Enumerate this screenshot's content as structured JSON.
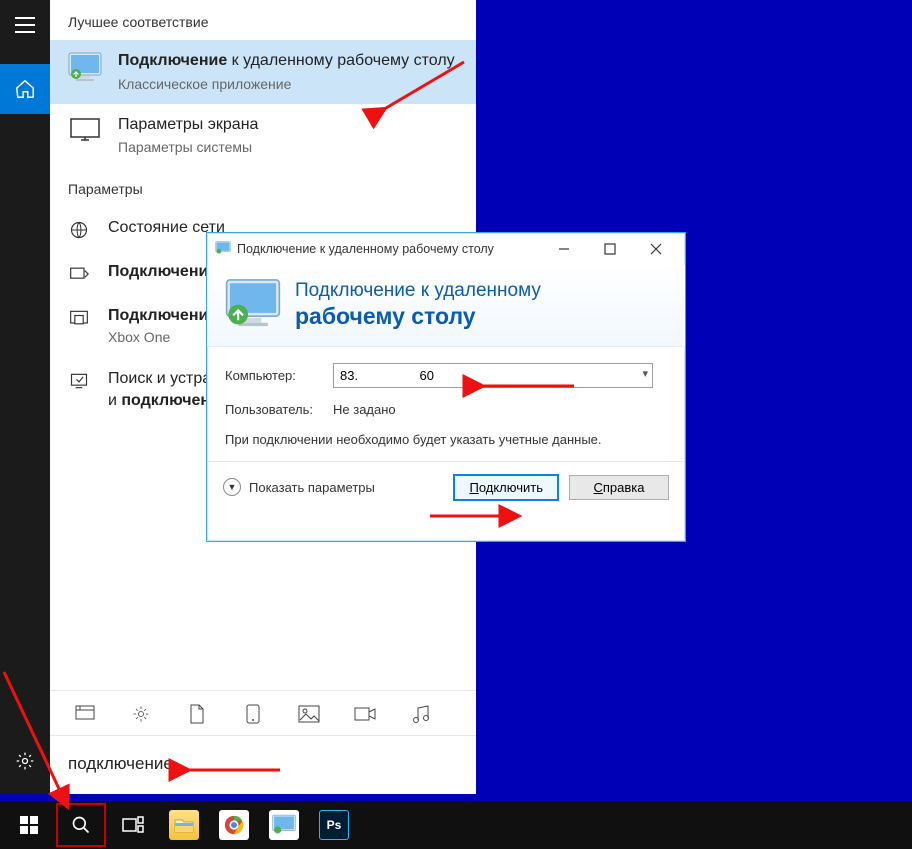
{
  "start": {
    "best_match_label": "Лучшее соответствие",
    "results": [
      {
        "title_prefix": "Подключение",
        "title_rest": " к удаленному рабочему столу",
        "subtitle": "Классическое приложение"
      },
      {
        "title_plain": "Параметры экрана",
        "subtitle": "Параметры системы"
      }
    ],
    "params_label": "Параметры",
    "settings_items": [
      {
        "text": "Состояние сети"
      },
      {
        "text_bold": "Подключение"
      },
      {
        "text_bold_prefix": "Подключение",
        "text_rest_html": "<br>Xbox One"
      },
      {
        "text_html": "Поиск и устранени<br>и <b>подключени</b>"
      }
    ],
    "search_text": "подключение"
  },
  "rdp": {
    "window_title": "Подключение к удаленному рабочему столу",
    "header_line1": "Подключение к удаленному",
    "header_line2": "рабочему столу",
    "computer_label": "Компьютер:",
    "computer_value": "83.                 60",
    "user_label": "Пользователь:",
    "user_value": "Не задано",
    "hint": "При подключении необходимо будет указать учетные данные.",
    "show_options": "Показать параметры",
    "connect": "Подключить",
    "help": "Справка"
  }
}
